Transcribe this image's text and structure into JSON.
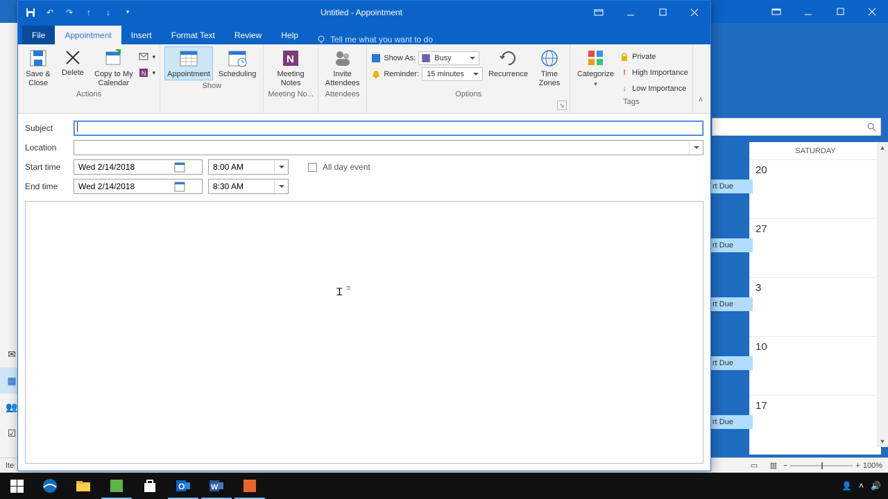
{
  "window": {
    "title": "Untitled  -  Appointment"
  },
  "tabs": {
    "file": "File",
    "appointment": "Appointment",
    "insert": "Insert",
    "format_text": "Format Text",
    "review": "Review",
    "help": "Help",
    "tell_me": "Tell me what you want to do"
  },
  "ribbon": {
    "actions": {
      "label": "Actions",
      "save_close": "Save &\nClose",
      "delete": "Delete",
      "copy_to_my_calendar": "Copy to My\nCalendar"
    },
    "show": {
      "label": "Show",
      "appointment": "Appointment",
      "scheduling": "Scheduling"
    },
    "meeting_notes": {
      "label": "Meeting No...",
      "meeting_notes": "Meeting\nNotes"
    },
    "attendees": {
      "label": "Attendees",
      "invite": "Invite\nAttendees"
    },
    "options": {
      "label": "Options",
      "show_as_label": "Show As:",
      "show_as_value": "Busy",
      "reminder_label": "Reminder:",
      "reminder_value": "15 minutes",
      "recurrence": "Recurrence",
      "time_zones": "Time\nZones"
    },
    "tags": {
      "label": "Tags",
      "categorize": "Categorize",
      "private": "Private",
      "high": "High Importance",
      "low": "Low Importance"
    }
  },
  "form": {
    "subject_label": "Subject",
    "subject_value": "",
    "location_label": "Location",
    "location_value": "",
    "start_label": "Start time",
    "start_date": "Wed 2/14/2018",
    "start_time": "8:00 AM",
    "end_label": "End time",
    "end_date": "Wed 2/14/2018",
    "end_time": "8:30 AM",
    "all_day": "All day event"
  },
  "background_calendar": {
    "day_header": "SATURDAY",
    "days": [
      "20",
      "27",
      "3",
      "10",
      "17"
    ],
    "event_label": "rt Due"
  },
  "statusbar": {
    "items_prefix": "Ite",
    "zoom": "100%"
  }
}
